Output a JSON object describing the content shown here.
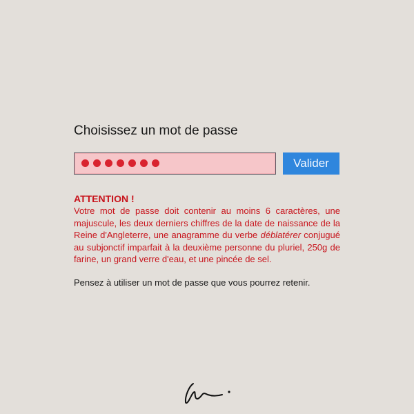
{
  "form": {
    "prompt": "Choisissez un mot de passe",
    "password_masked_count": 7,
    "mask_color": "#d9232f",
    "field_bg_color": "#f6c6c9",
    "submit_label": "Valider",
    "submit_color": "#2f86dd"
  },
  "warning": {
    "title": "ATTENTION !",
    "body_part1": "Votre mot de passe doit contenir au moins 6 caractères, une majuscule, les deux derniers chiffres de la date de naissance de la Reine d'Angleterre, une anagramme du verbe ",
    "body_emphasis": "déblatérer",
    "body_part2": " conjugué au subjonctif imparfait à la deuxième personne du pluriel, 250g de farine, un grand verre d'eau, et une pincée de sel.",
    "color": "#c8141c"
  },
  "reminder": "Pensez à utiliser un mot de passe que vous pourrez retenir.",
  "signature_icon": "signature-mark"
}
